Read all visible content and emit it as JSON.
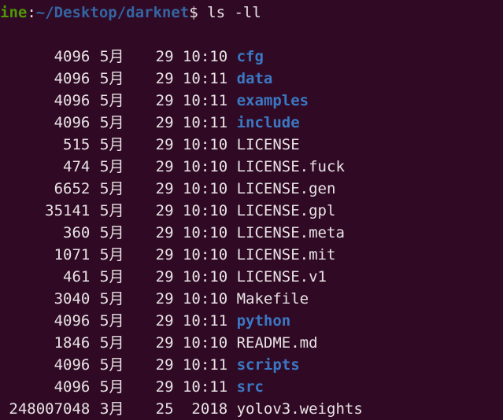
{
  "terminal": {
    "background_color": "#300a24",
    "foreground_color": "#e8e3e5",
    "dir_color": "#3b78c4",
    "prompt_host_color": "#4e9a06",
    "prompt_path_color": "#3465a4"
  },
  "prompt": {
    "host": "ine",
    "separator": ":",
    "path": "~/Desktop/darknet",
    "sigil": "$",
    "command": "ls -ll"
  },
  "listing": {
    "rows": [
      {
        "size": "4096",
        "month": "5月",
        "day": "29",
        "time": "10:10",
        "name": "cfg",
        "type": "dir"
      },
      {
        "size": "4096",
        "month": "5月",
        "day": "29",
        "time": "10:11",
        "name": "data",
        "type": "dir"
      },
      {
        "size": "4096",
        "month": "5月",
        "day": "29",
        "time": "10:11",
        "name": "examples",
        "type": "dir"
      },
      {
        "size": "4096",
        "month": "5月",
        "day": "29",
        "time": "10:11",
        "name": "include",
        "type": "dir"
      },
      {
        "size": "515",
        "month": "5月",
        "day": "29",
        "time": "10:10",
        "name": "LICENSE",
        "type": "file"
      },
      {
        "size": "474",
        "month": "5月",
        "day": "29",
        "time": "10:10",
        "name": "LICENSE.fuck",
        "type": "file"
      },
      {
        "size": "6652",
        "month": "5月",
        "day": "29",
        "time": "10:10",
        "name": "LICENSE.gen",
        "type": "file"
      },
      {
        "size": "35141",
        "month": "5月",
        "day": "29",
        "time": "10:10",
        "name": "LICENSE.gpl",
        "type": "file"
      },
      {
        "size": "360",
        "month": "5月",
        "day": "29",
        "time": "10:10",
        "name": "LICENSE.meta",
        "type": "file"
      },
      {
        "size": "1071",
        "month": "5月",
        "day": "29",
        "time": "10:10",
        "name": "LICENSE.mit",
        "type": "file"
      },
      {
        "size": "461",
        "month": "5月",
        "day": "29",
        "time": "10:10",
        "name": "LICENSE.v1",
        "type": "file"
      },
      {
        "size": "3040",
        "month": "5月",
        "day": "29",
        "time": "10:10",
        "name": "Makefile",
        "type": "file"
      },
      {
        "size": "4096",
        "month": "5月",
        "day": "29",
        "time": "10:11",
        "name": "python",
        "type": "dir"
      },
      {
        "size": "1846",
        "month": "5月",
        "day": "29",
        "time": "10:10",
        "name": "README.md",
        "type": "file"
      },
      {
        "size": "4096",
        "month": "5月",
        "day": "29",
        "time": "10:11",
        "name": "scripts",
        "type": "dir"
      },
      {
        "size": "4096",
        "month": "5月",
        "day": "29",
        "time": "10:11",
        "name": "src",
        "type": "dir"
      },
      {
        "size": "248007048",
        "month": "3月",
        "day": "25",
        "time": "2018",
        "name": "yolov3.weights",
        "type": "file"
      }
    ]
  }
}
